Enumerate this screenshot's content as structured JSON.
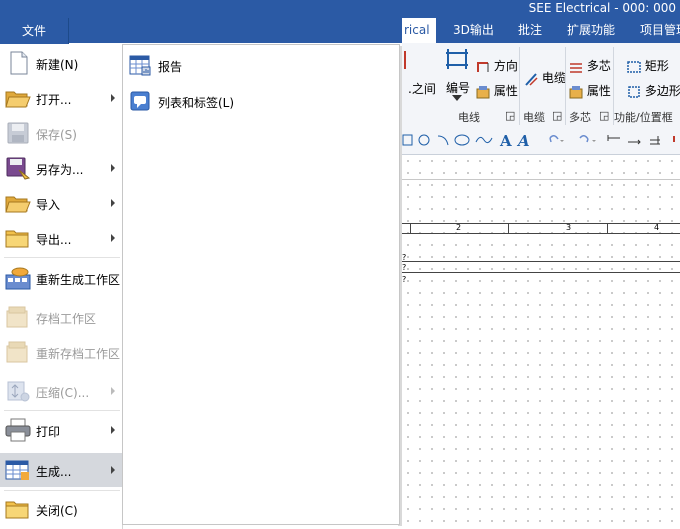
{
  "window": {
    "title": "SEE Electrical - 000: 000"
  },
  "tabs": [
    {
      "label": "rical",
      "active": true
    },
    {
      "label": "3D输出"
    },
    {
      "label": "批注"
    },
    {
      "label": "扩展功能"
    },
    {
      "label": "项目管理"
    }
  ],
  "file_tab": {
    "label": "文件"
  },
  "ribbon": {
    "items": {
      "between": "之间",
      "number": "编号",
      "direction": "方向",
      "attribute1": "属性",
      "cable": "电缆",
      "multicore": "多芯",
      "attribute2": "属性",
      "rect": "矩形",
      "polygon": "多边形"
    },
    "groups": {
      "wire": "电线",
      "cable": "电缆",
      "multicore": "多芯",
      "function_location": "功能/位置框"
    }
  },
  "canvas": {
    "columns": [
      "2",
      "3",
      "4"
    ],
    "marker": "?"
  },
  "file_menu": {
    "items": [
      {
        "label": "新建(N)",
        "enabled": true,
        "submenu": false,
        "icon": "new-document-icon"
      },
      {
        "label": "打开...",
        "enabled": true,
        "submenu": true,
        "icon": "open-folder-icon"
      },
      {
        "label": "保存(S)",
        "enabled": false,
        "submenu": false,
        "icon": "save-disk-icon"
      },
      {
        "label": "另存为...",
        "enabled": true,
        "submenu": true,
        "icon": "save-as-icon"
      },
      {
        "label": "导入",
        "enabled": true,
        "submenu": true,
        "icon": "import-folder-icon"
      },
      {
        "label": "导出...",
        "enabled": true,
        "submenu": true,
        "icon": "export-folder-icon"
      },
      {
        "label": "重新生成工作区",
        "enabled": true,
        "submenu": false,
        "icon": "regenerate-workspace-icon"
      },
      {
        "label": "存档工作区",
        "enabled": false,
        "submenu": false,
        "icon": "archive-workspace-icon"
      },
      {
        "label": "重新存档工作区",
        "enabled": false,
        "submenu": false,
        "icon": "rearchive-workspace-icon"
      },
      {
        "label": "压缩(C)...",
        "enabled": false,
        "submenu": true,
        "icon": "compress-icon"
      },
      {
        "label": "打印",
        "enabled": true,
        "submenu": true,
        "icon": "printer-icon"
      },
      {
        "label": "生成...",
        "enabled": true,
        "submenu": true,
        "selected": true,
        "icon": "generate-table-icon"
      },
      {
        "label": "关闭(C)",
        "enabled": true,
        "submenu": false,
        "icon": "close-folder-icon"
      }
    ],
    "generate_submenu": [
      {
        "label": "报告",
        "icon": "report-icon"
      },
      {
        "label": "列表和标签(L)",
        "icon": "list-label-icon"
      }
    ]
  },
  "colors": {
    "accent": "#2b5aa5",
    "selected_bg": "#d5d8dd",
    "disabled_text": "#9a9a9a"
  }
}
